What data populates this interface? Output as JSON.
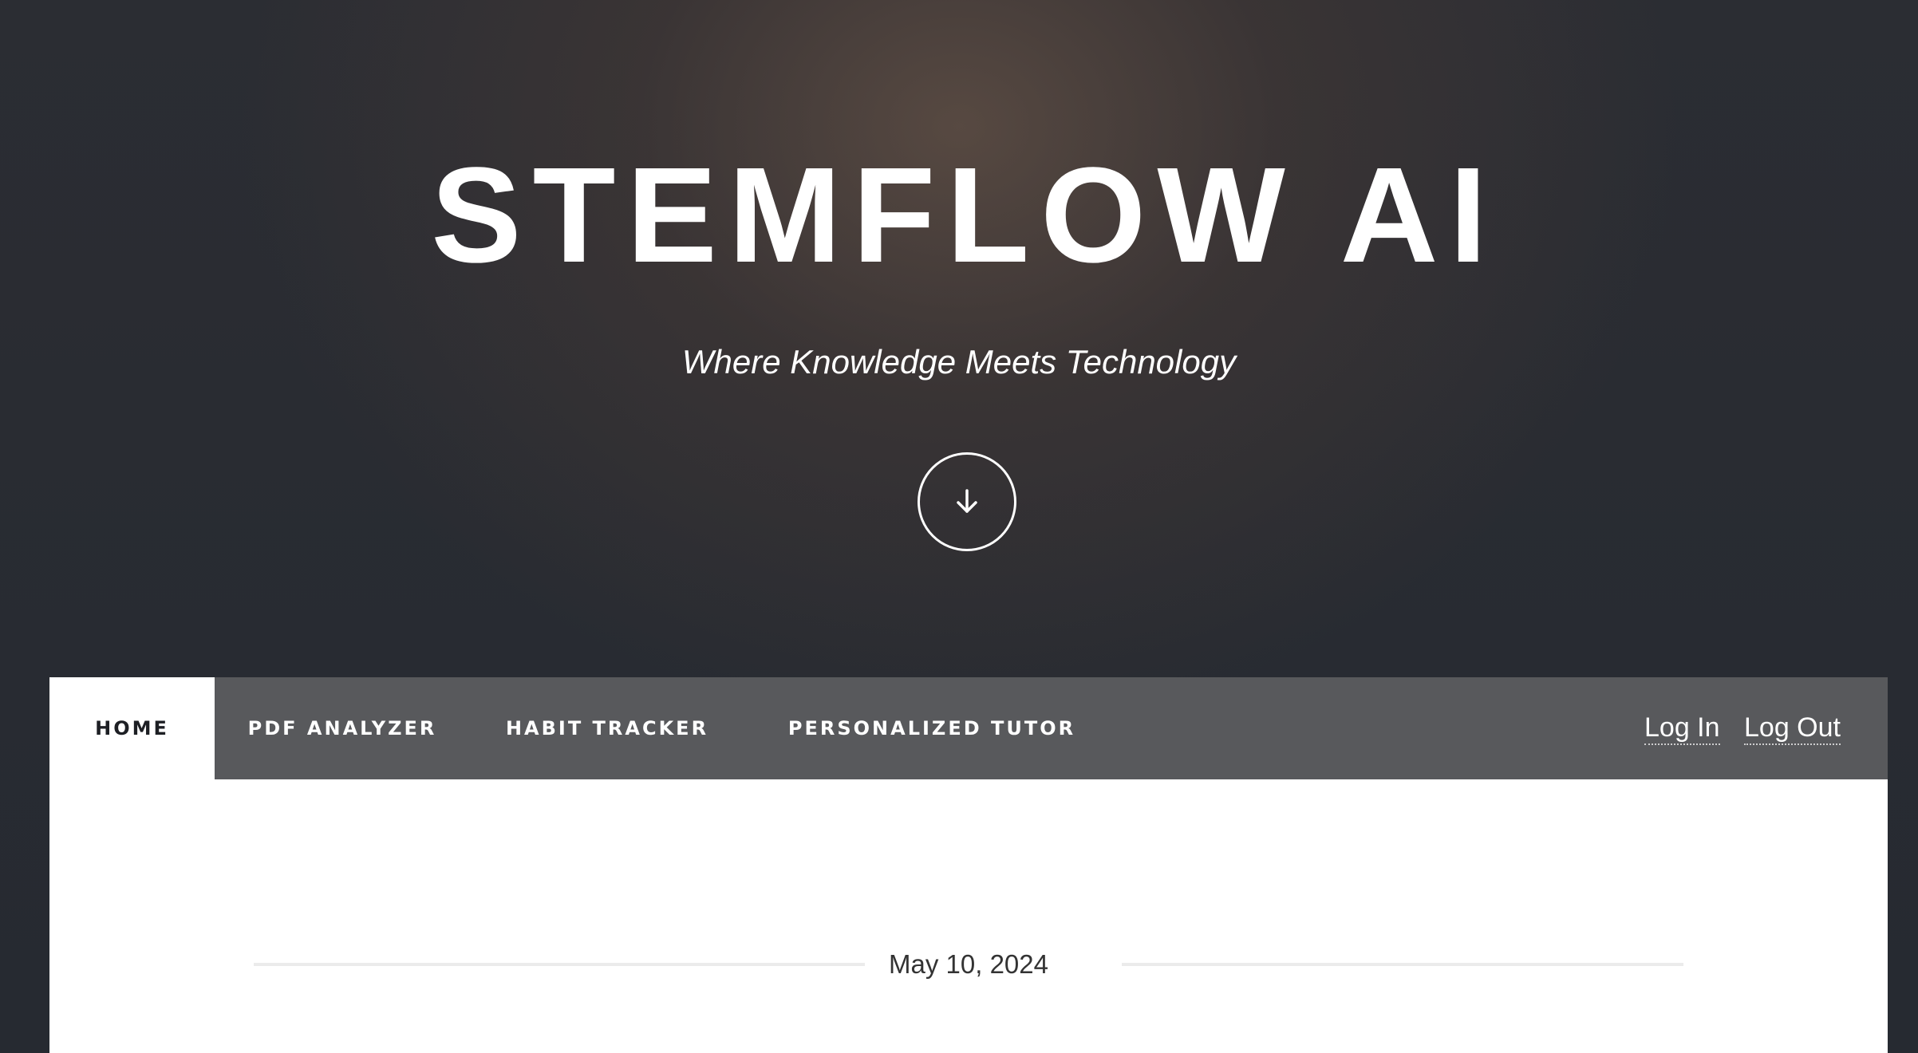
{
  "hero": {
    "title": "STEMFLOW AI",
    "tagline": "Where Knowledge Meets Technology",
    "scroll_icon": "arrow-down-icon"
  },
  "nav": {
    "items": [
      {
        "label": "Home",
        "active": true
      },
      {
        "label": "PDF Analyzer",
        "active": false
      },
      {
        "label": "Habit Tracker",
        "active": false
      },
      {
        "label": "Personalized Tutor",
        "active": false
      }
    ],
    "auth": {
      "login_label": "Log In",
      "logout_label": "Log Out"
    }
  },
  "main": {
    "date": "May 10, 2024"
  },
  "colors": {
    "nav_background": "#58595c",
    "panel_background": "#ffffff",
    "text_dark": "#1d1f24",
    "page_background": "#252a31"
  }
}
